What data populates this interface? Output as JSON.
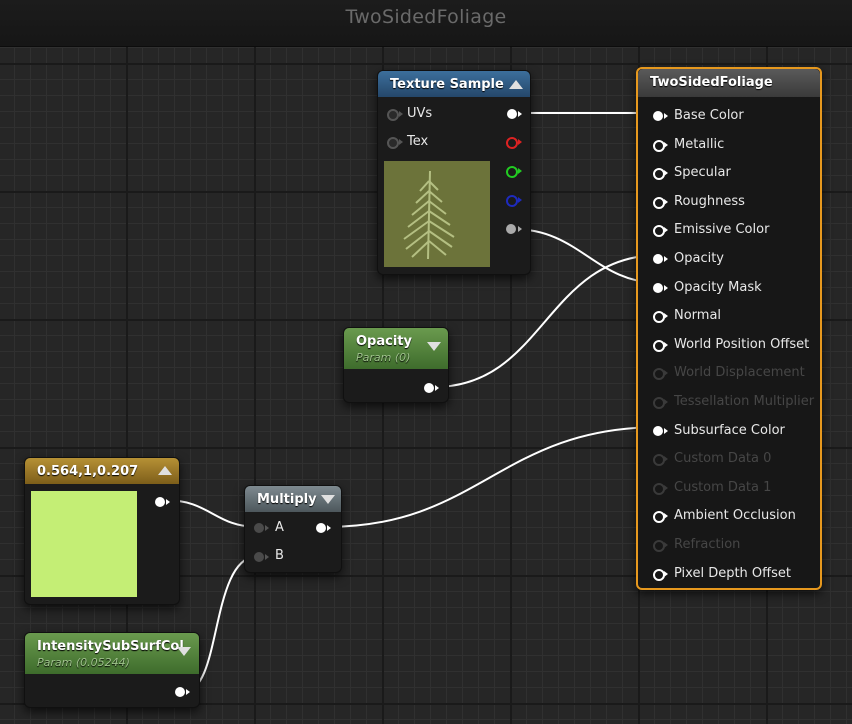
{
  "window": {
    "title": "TwoSidedFoliage"
  },
  "nodes": {
    "texture_sample": {
      "title": "Texture Sample",
      "inputs": [
        "UVs",
        "Tex"
      ]
    },
    "result": {
      "title": "TwoSidedFoliage",
      "pins": [
        {
          "label": "Base Color",
          "enabled": true
        },
        {
          "label": "Metallic",
          "enabled": true
        },
        {
          "label": "Specular",
          "enabled": true
        },
        {
          "label": "Roughness",
          "enabled": true
        },
        {
          "label": "Emissive Color",
          "enabled": true
        },
        {
          "label": "Opacity",
          "enabled": true
        },
        {
          "label": "Opacity Mask",
          "enabled": true
        },
        {
          "label": "Normal",
          "enabled": true
        },
        {
          "label": "World Position Offset",
          "enabled": true
        },
        {
          "label": "World Displacement",
          "enabled": false
        },
        {
          "label": "Tessellation Multiplier",
          "enabled": false
        },
        {
          "label": "Subsurface Color",
          "enabled": true
        },
        {
          "label": "Custom Data 0",
          "enabled": false
        },
        {
          "label": "Custom Data 1",
          "enabled": false
        },
        {
          "label": "Ambient Occlusion",
          "enabled": true
        },
        {
          "label": "Refraction",
          "enabled": false
        },
        {
          "label": "Pixel Depth Offset",
          "enabled": true
        }
      ]
    },
    "opacity_param": {
      "title": "Opacity",
      "subtitle": "Param (0)"
    },
    "color_constant": {
      "title": "0.564,1,0.207",
      "swatch_color": "#c4ee75"
    },
    "multiply": {
      "title": "Multiply",
      "inputs": [
        "A",
        "B"
      ]
    },
    "intensity_param": {
      "title": "IntensitySubSurfCol",
      "subtitle": "Param (0.05244)"
    }
  },
  "colors": {
    "selected_border": "#e6981e",
    "texture_header": "#3c6f9c",
    "param_header": "#5a8a3e",
    "constant_header": "#a08028",
    "multiply_header": "#6e7a80"
  }
}
